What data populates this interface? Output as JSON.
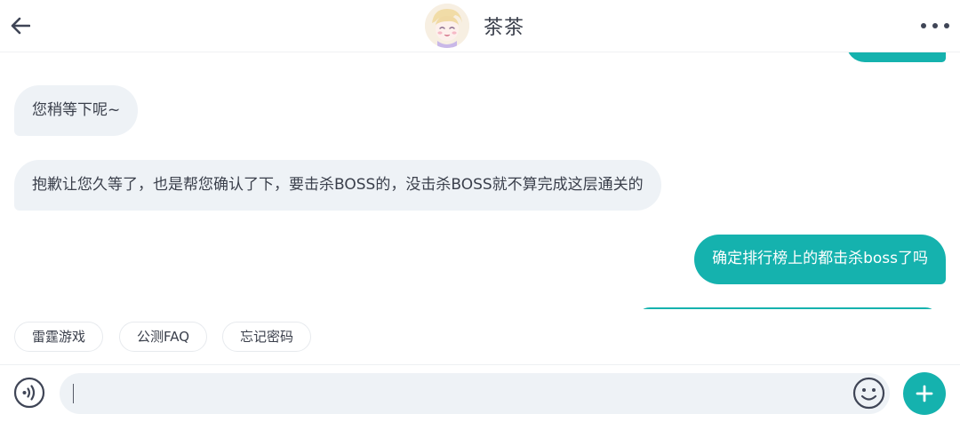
{
  "header": {
    "title": "茶茶",
    "back_icon": "arrow-left-icon",
    "more_icon": "more-horizontal-icon",
    "avatar": "anime-girl-avatar"
  },
  "colors": {
    "accent": "#15b2ae",
    "incoming_bubble": "#eef2f6",
    "text": "#3a3f4b"
  },
  "messages": [
    {
      "from": "agent",
      "text": "您稍等下呢~"
    },
    {
      "from": "agent",
      "text": "抱歉让您久等了，也是帮您确认了下，要击杀BOSS的，没击杀BOSS就不算完成这层通关的"
    },
    {
      "from": "user",
      "text": "确定排行榜上的都击杀boss了吗"
    }
  ],
  "quick_replies": [
    "雷霆游戏",
    "公测FAQ",
    "忘记密码"
  ],
  "input": {
    "value": "",
    "voice_icon": "voice-icon",
    "emoji_icon": "emoji-icon",
    "plus_icon": "plus-icon"
  }
}
